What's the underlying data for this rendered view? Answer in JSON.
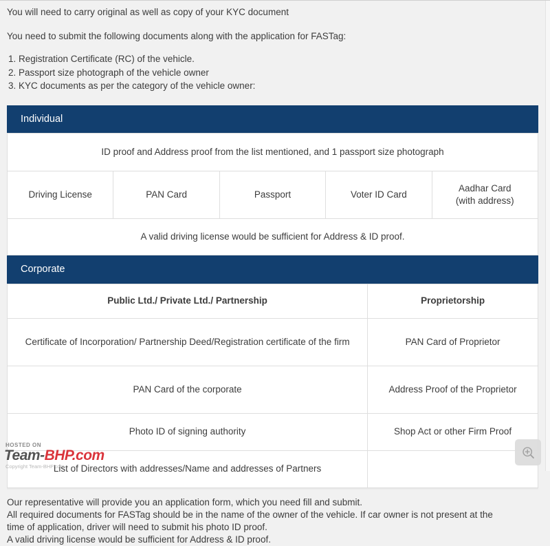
{
  "intro": {
    "line_1": "You will need to carry original as well as copy of your KYC document",
    "line_2": "You need to submit the following documents along with the application for FASTag:",
    "list": [
      {
        "num": "1.",
        "text": "Registration Certificate (RC) of the vehicle."
      },
      {
        "num": "2.",
        "text": "Passport size photograph of the vehicle owner"
      },
      {
        "num": "3.",
        "text": "KYC documents as per the category of the vehicle owner:"
      }
    ]
  },
  "individual_table": {
    "header": "Individual",
    "top_note": "ID proof and Address proof from the list mentioned, and 1 passport size photograph",
    "id_options": [
      "Driving License",
      "PAN Card",
      "Passport",
      "Voter ID Card",
      "Aadhar Card\n(with address)"
    ],
    "id_option_1": "Driving License",
    "id_option_2": "PAN Card",
    "id_option_3": "Passport",
    "id_option_4": "Voter ID Card",
    "id_option_5_line_1": "Aadhar Card",
    "id_option_5_line_2": "(with address)",
    "bottom_note": "A valid driving license would be sufficient for Address & ID proof."
  },
  "corporate_table": {
    "header": "Corporate",
    "col_head_left": "Public Ltd./ Private Ltd./ Partnership",
    "col_head_right": "Proprietorship",
    "rows": [
      {
        "left": "Certificate of Incorporation/ Partnership Deed/Registration certificate of the firm",
        "right": "PAN Card of Proprietor"
      },
      {
        "left": "PAN Card of the corporate",
        "right": "Address Proof of the Proprietor"
      },
      {
        "left": "Photo ID of signing authority",
        "right": "Shop Act or other Firm Proof"
      },
      {
        "left": "List of Directors with addresses/Name and addresses of Partners",
        "right": ""
      }
    ],
    "row_1_left": "Certificate of Incorporation/ Partnership Deed/Registration certificate of the firm",
    "row_1_right": "PAN Card of Proprietor",
    "row_2_left": "PAN Card of the corporate",
    "row_2_right": "Address Proof of the Proprietor",
    "row_3_left": "Photo ID of signing authority",
    "row_3_right": "Shop Act or other Firm Proof",
    "row_4_left": "List of Directors with addresses/Name and addresses of Partners",
    "row_4_right": ""
  },
  "footer": {
    "line_1": "Our representative will provide you an application form, which you need fill and submit.",
    "line_2": "All required documents for FASTag should be in the name of the owner of the vehicle. If car owner is not present at the",
    "line_3": "time of application, driver will need to submit his photo ID proof.",
    "line_4": "A valid driving license would be sufficient for Address & ID proof."
  },
  "watermark": {
    "hosted_on": "HOSTED ON",
    "brand_first": "Team-",
    "brand_second": "BHP.com",
    "subtext": "Copyright Team-BHP.com"
  },
  "controls": {
    "zoom_icon": "zoom-in-icon"
  },
  "colors": {
    "header_blue": "#123f6f",
    "page_background": "#f1f1f1",
    "cell_background": "#ffffff",
    "border_gray": "#dedede",
    "text": "#3c3c3c",
    "watermark_red": "#d51920"
  }
}
